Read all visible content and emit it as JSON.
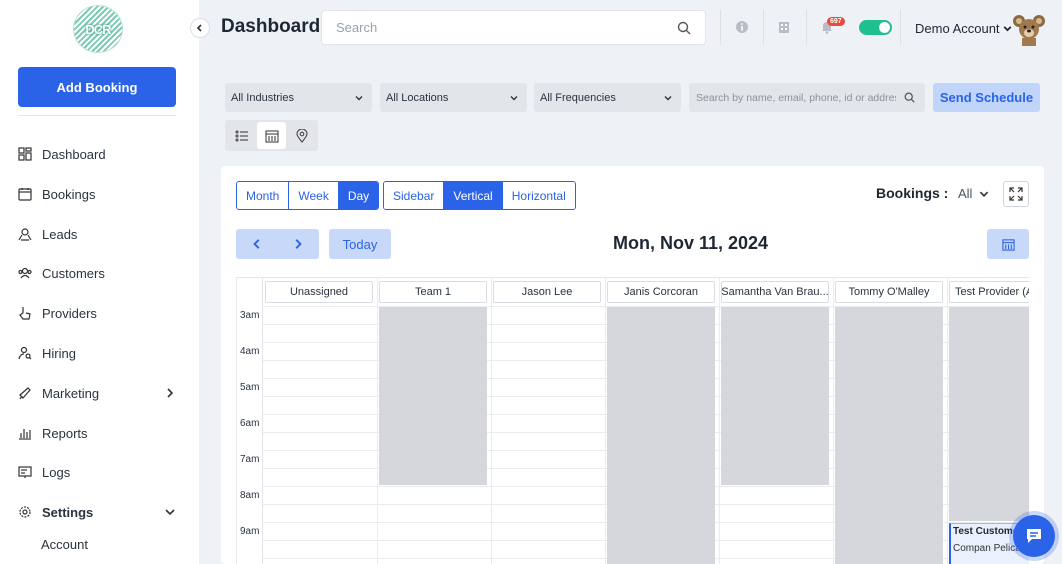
{
  "sidebar": {
    "logo_text": "DCR",
    "add_booking_label": "Add Booking",
    "items": [
      {
        "label": "Dashboard",
        "icon": "grid-icon"
      },
      {
        "label": "Bookings",
        "icon": "calendar-icon"
      },
      {
        "label": "Leads",
        "icon": "leads-icon"
      },
      {
        "label": "Customers",
        "icon": "users-icon"
      },
      {
        "label": "Providers",
        "icon": "hand-icon"
      },
      {
        "label": "Hiring",
        "icon": "user-search-icon"
      },
      {
        "label": "Marketing",
        "icon": "megaphone-icon"
      },
      {
        "label": "Reports",
        "icon": "chart-icon"
      },
      {
        "label": "Logs",
        "icon": "log-icon"
      },
      {
        "label": "Settings",
        "icon": "gear-icon"
      }
    ],
    "sub_item": "Account"
  },
  "header": {
    "title": "Dashboard",
    "search_placeholder": "Search",
    "notification_count": "697",
    "account_name": "Demo Account"
  },
  "filters": {
    "industries": "All Industries",
    "locations": "All Locations",
    "frequencies": "All Frequencies",
    "search_placeholder": "Search by name, email, phone, id or address",
    "send_schedule": "Send Schedule"
  },
  "calendar": {
    "range_views": [
      "Month",
      "Week",
      "Day"
    ],
    "active_range": "Day",
    "layout_views": [
      "Sidebar",
      "Vertical",
      "Horizontal"
    ],
    "active_layout": "Vertical",
    "bookings_label": "Bookings :",
    "bookings_filter": "All",
    "today_label": "Today",
    "date": "Mon, Nov 11, 2024",
    "resources": [
      "Unassigned",
      "Team 1",
      "Jason Lee",
      "Janis Corcoran",
      "Samantha Van Brau...",
      "Tommy O'Malley",
      "Test Provider (Al"
    ],
    "times": [
      "3am",
      "4am",
      "5am",
      "6am",
      "7am",
      "8am",
      "9am"
    ],
    "event": {
      "title": "Test Customer",
      "subtitle": "Compan  Pelican"
    }
  },
  "colors": {
    "primary": "#2b63e8",
    "toggle": "#1fbf8f",
    "badge": "#e74c3c",
    "unavailable": "#d5d7dd"
  }
}
